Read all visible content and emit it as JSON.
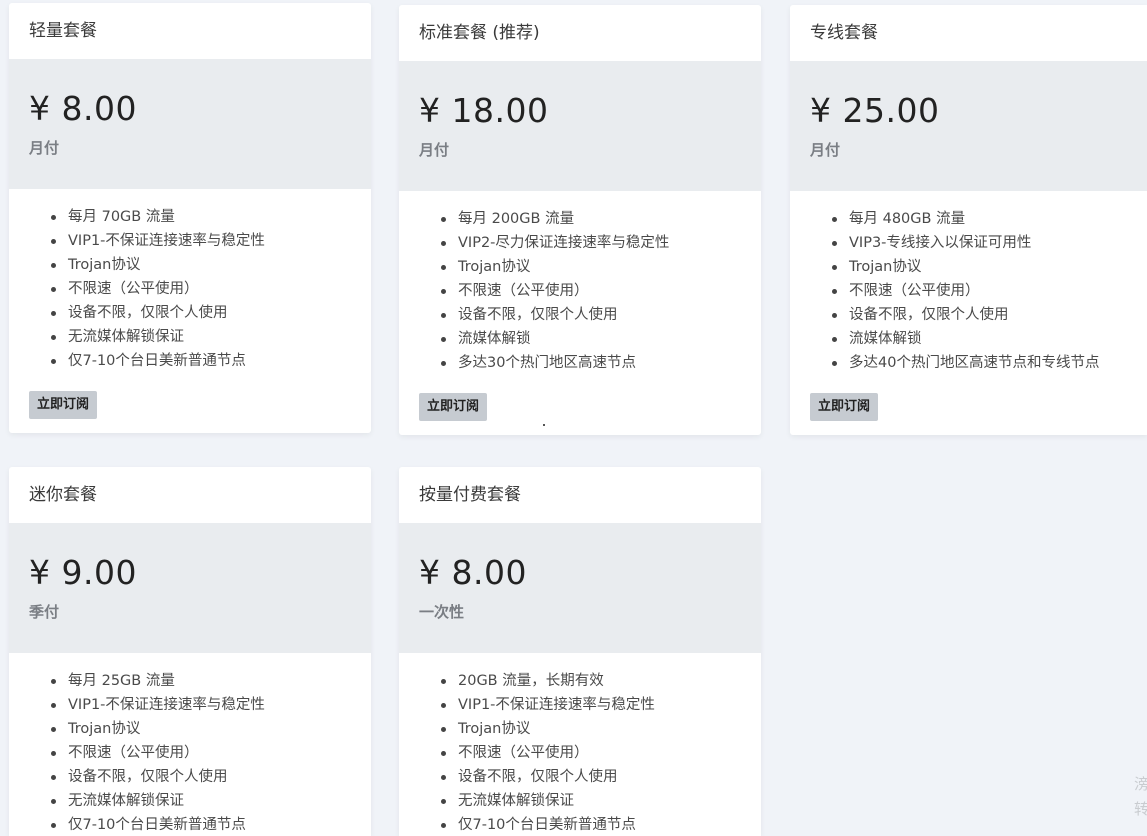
{
  "plans": [
    {
      "title": "轻量套餐",
      "price": "¥ 8.00",
      "period": "月付",
      "features": [
        "每月 70GB 流量",
        "VIP1-不保证连接速率与稳定性",
        "Trojan协议",
        "不限速（公平使用）",
        "设备不限，仅限个人使用",
        "无流媒体解锁保证",
        "仅7-10个台日美新普通节点"
      ],
      "button": "立即订阅"
    },
    {
      "title": "标准套餐 (推荐)",
      "price": "¥ 18.00",
      "period": "月付",
      "features": [
        "每月 200GB 流量",
        "VIP2-尽力保证连接速率与稳定性",
        "Trojan协议",
        "不限速（公平使用）",
        "设备不限，仅限个人使用",
        "流媒体解锁",
        "多达30个热门地区高速节点"
      ],
      "button": "立即订阅"
    },
    {
      "title": "专线套餐",
      "price": "¥ 25.00",
      "period": "月付",
      "features": [
        "每月 480GB 流量",
        "VIP3-专线接入以保证可用性",
        "Trojan协议",
        "不限速（公平使用）",
        "设备不限，仅限个人使用",
        "流媒体解锁",
        "多达40个热门地区高速节点和专线节点"
      ],
      "button": "立即订阅"
    },
    {
      "title": "迷你套餐",
      "price": "¥ 9.00",
      "period": "季付",
      "features": [
        "每月 25GB 流量",
        "VIP1-不保证连接速率与稳定性",
        "Trojan协议",
        "不限速（公平使用）",
        "设备不限，仅限个人使用",
        "无流媒体解锁保证",
        "仅7-10个台日美新普通节点"
      ]
    },
    {
      "title": "按量付费套餐",
      "price": "¥ 8.00",
      "period": "一次性",
      "features": [
        "20GB 流量，长期有效",
        "VIP1-不保证连接速率与稳定性",
        "Trojan协议",
        "不限速（公平使用）",
        "设备不限，仅限个人使用",
        "无流媒体解锁保证",
        "仅7-10个台日美新普通节点"
      ]
    }
  ],
  "corner_text": [
    "滂",
    "转"
  ]
}
